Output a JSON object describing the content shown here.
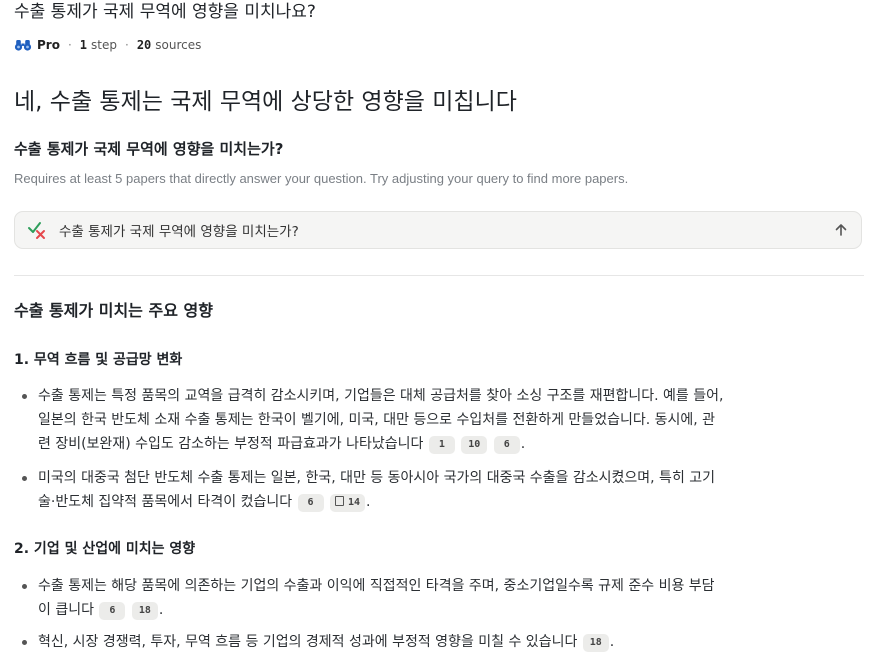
{
  "question_title": "수출 통제가 국제 무역에 영향을 미치나요?",
  "meta": {
    "mode": "Pro",
    "steps_count": "1",
    "steps_label": "step",
    "sources_count": "20",
    "sources_label": "sources"
  },
  "headline": "네, 수출 통제는 국제 무역에 상당한 영향을 미칩니다",
  "sub_question": "수출 통제가 국제 무역에 영향을 미치는가?",
  "note": "Requires at least 5 papers that directly answer your question. Try adjusting your query to find more papers.",
  "search_query": "수출 통제가 국제 무역에 영향을 미치는가?",
  "section_title": "수출 통제가 미치는 주요 영향",
  "subsections": [
    {
      "heading": "1. 무역 흐름 및 공급망 변화",
      "bullets": [
        {
          "line1": "수출 통제는 특정 품목의 교역을 급격히 감소시키며, 기업들은 대체 공급처를 찾아 소싱 구조를 재편합니다. 예를 들어,",
          "line2": "일본의 한국 반도체 소재 수출 통제는 한국이 벨기에, 미국, 대만 등으로 수입처를 전환하게 만들었습니다. 동시에, 관",
          "line3": "련 장비(보완재) 수입도 감소하는 부정적 파급효과가 나타났습니다",
          "cites": [
            "1",
            "10",
            "6"
          ]
        },
        {
          "line1": "미국의 대중국 첨단 반도체 수출 통제는 일본, 한국, 대만 등 동아시아 국가의 대중국 수출을 감소시켰으며, 특히 고기",
          "line2": "술·반도체 집약적 품목에서 타격이 컸습니다",
          "cites": [
            "6",
            "14"
          ]
        }
      ]
    },
    {
      "heading": "2. 기업 및 산업에 미치는 영향",
      "bullets": [
        {
          "line1": "수출 통제는 해당 품목에 의존하는 기업의 수출과 이익에 직접적인 타격을 주며, 중소기업일수록 규제 준수 비용 부담",
          "line2": "이 큽니다",
          "cites": [
            "6",
            "18"
          ]
        },
        {
          "line1": "혁신, 시장 경쟁력, 투자, 무역 흐름 등 기업의 경제적 성과에 부정적 영향을 미칠 수 있습니다",
          "cites": [
            "18"
          ]
        }
      ]
    }
  ],
  "icons": {
    "mode": "binoculars-icon",
    "search": "check-cross-icon",
    "submit": "arrow-up-icon"
  },
  "colors": {
    "accent_blue": "#1f5fbf",
    "error_red": "#e5484d",
    "check_green": "#2e9e5b"
  }
}
